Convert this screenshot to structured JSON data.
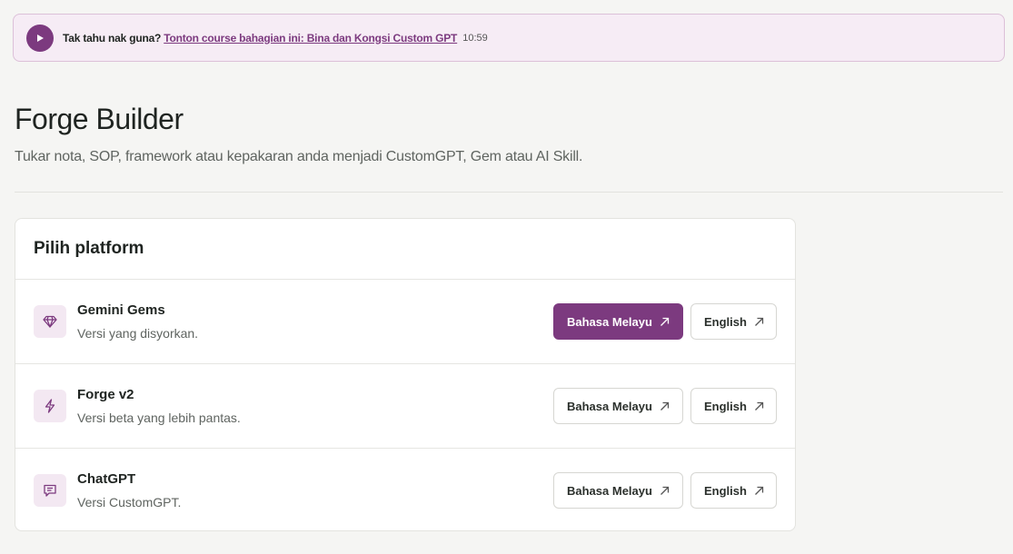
{
  "banner": {
    "lead": "Tak tahu nak guna?",
    "link": "Tonton course bahagian ini: Bina dan Kongsi Custom GPT",
    "duration": "10:59",
    "icon": "play-icon",
    "accent": "#7c3a7f"
  },
  "header": {
    "title": "Forge Builder",
    "subtitle": "Tukar nota, SOP, framework atau kepakaran anda menjadi CustomGPT, Gem atau AI Skill."
  },
  "card": {
    "title": "Pilih platform",
    "platforms": [
      {
        "name": "Gemini Gems",
        "desc": "Versi yang disyorkan.",
        "icon": "diamond-icon",
        "malay_label": "Bahasa Melayu",
        "english_label": "English",
        "recommended": true
      },
      {
        "name": "Forge v2",
        "desc": "Versi beta yang lebih pantas.",
        "icon": "lightning-icon",
        "malay_label": "Bahasa Melayu",
        "english_label": "English",
        "recommended": false
      },
      {
        "name": "ChatGPT",
        "desc": "Versi CustomGPT.",
        "icon": "chat-icon",
        "malay_label": "Bahasa Melayu",
        "english_label": "English",
        "recommended": false
      }
    ]
  },
  "colors": {
    "accent": "#7c3a7f",
    "page_bg": "#f5f5f3",
    "banner_bg": "#f6ecf5"
  }
}
